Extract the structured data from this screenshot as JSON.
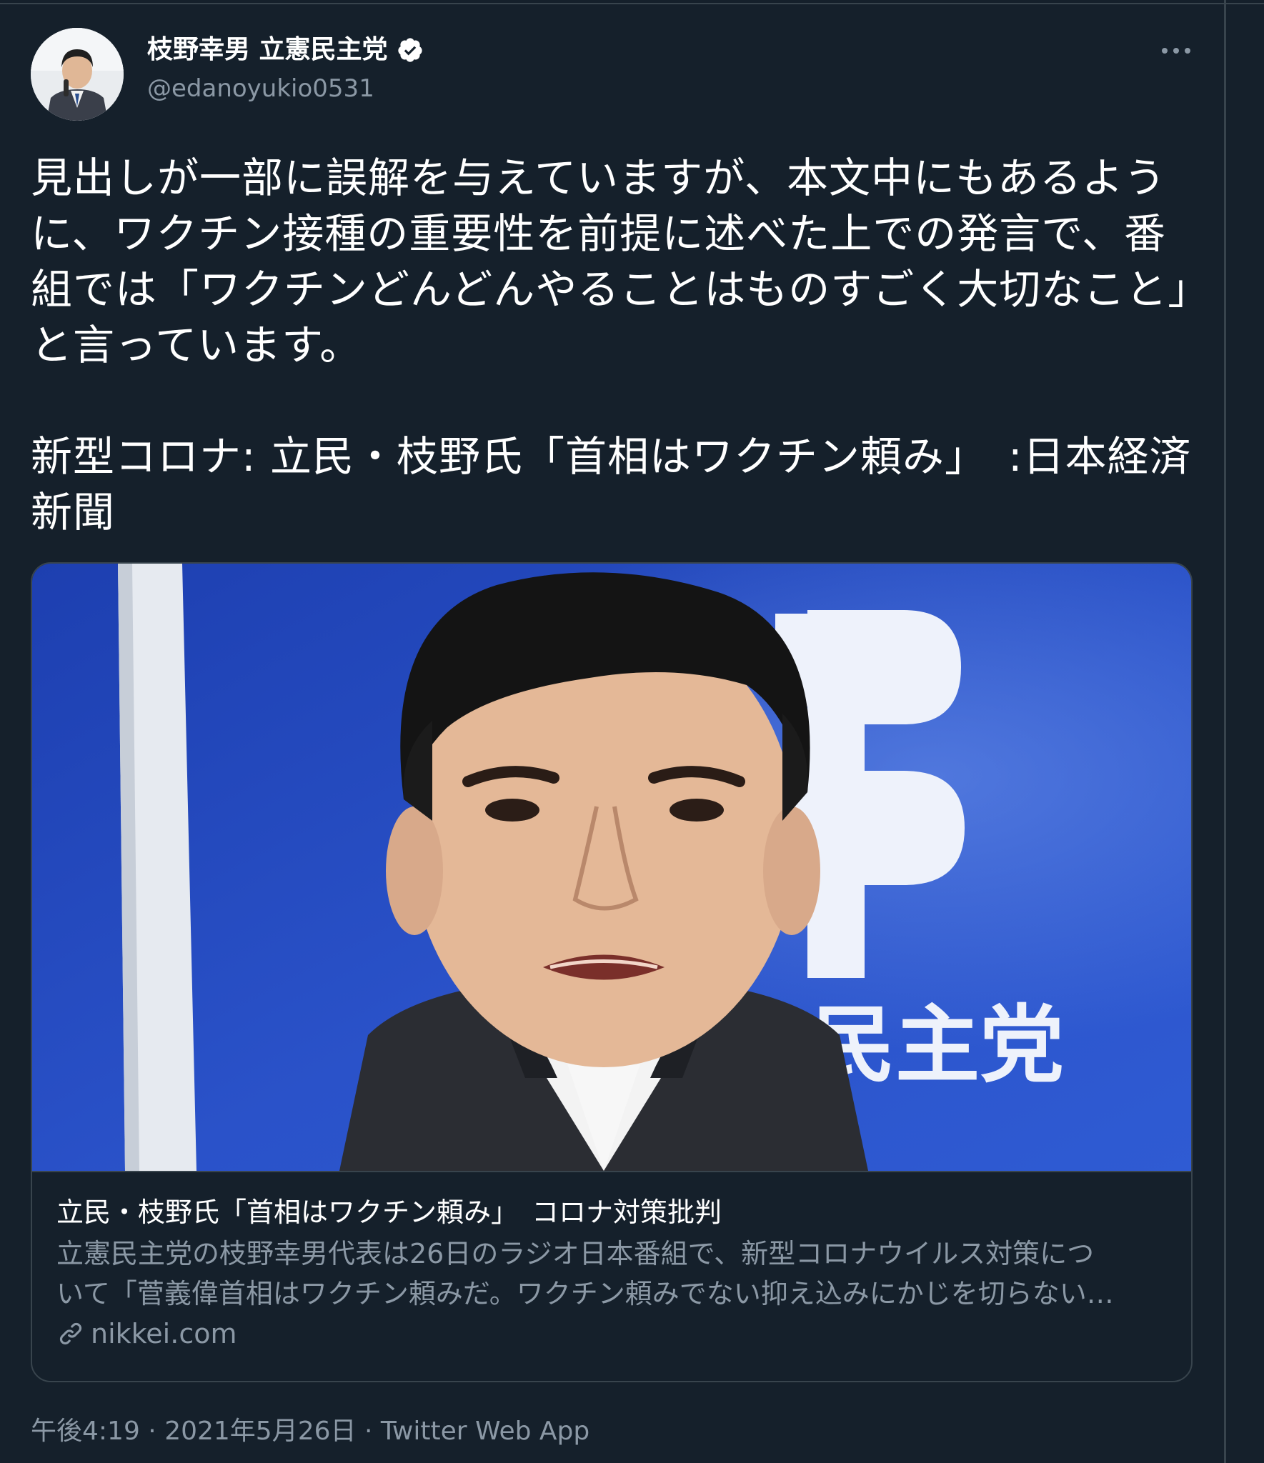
{
  "colors": {
    "background": "#15202b",
    "border": "#38444d",
    "text_primary": "#ffffff",
    "text_secondary": "#8b98a5"
  },
  "author": {
    "display_name": "枝野幸男 立憲民主党",
    "handle": "@edanoyukio0531",
    "verified_icon": "verified-badge-icon",
    "avatar": "avatar-photo"
  },
  "more_icon": "more-options-icon",
  "tweet": {
    "paragraphs": [
      "見出しが一部に誤解を与えていますが、本文中にもあるように、ワクチン接種の重要性を前提に述べた上での発言で、番組では「ワクチンどんどんやることはものすごく大切なこと」と言っています。",
      "新型コロナ: 立民・枝野氏「首相はワクチン頼み」　:日本経済新聞"
    ]
  },
  "card": {
    "title": "立民・枝野氏「首相はワクチン頼み」　コロナ対策批判",
    "description_lines": [
      "立憲民主党の枝野幸男代表は26日のラジオ日本番組で、新型コロナウイルス対策につ",
      "いて「菅義偉首相はワクチン頼みだ。ワクチン頼みでない抑え込みにかじを切らない…"
    ],
    "domain": "nikkei.com",
    "link_icon": "link-icon",
    "image_text": "民主党"
  },
  "meta": {
    "time": "午後4:19",
    "date": "2021年5月26日",
    "source": "Twitter Web App",
    "separator": " · "
  }
}
